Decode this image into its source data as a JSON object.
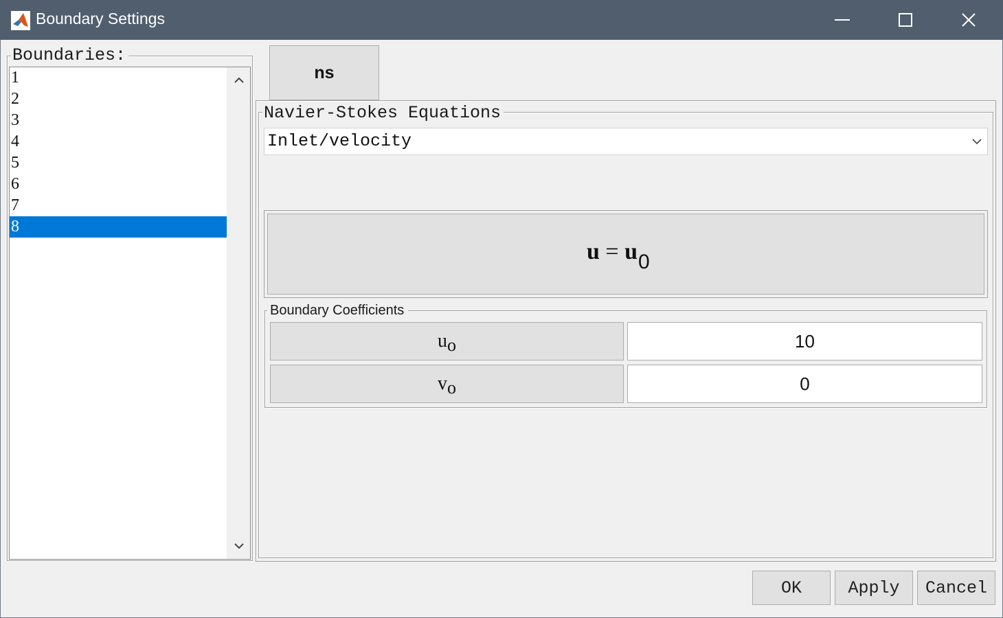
{
  "window": {
    "title": "Boundary Settings",
    "icon": "matlab-icon"
  },
  "boundaries": {
    "legend": "Boundaries:",
    "items": [
      "1",
      "2",
      "3",
      "4",
      "5",
      "6",
      "7",
      "8"
    ],
    "selected": "8"
  },
  "tab": {
    "label": "ns"
  },
  "equations": {
    "legend": "Navier-Stokes Equations",
    "condition_type": "Inlet/velocity",
    "equation_lhs": "u",
    "equation_op": "=",
    "equation_rhs": "u",
    "equation_rhs_sub": "0"
  },
  "coefficients": {
    "legend": "Boundary Coefficients",
    "rows": [
      {
        "symbol": "u",
        "sub": "o",
        "value": "10"
      },
      {
        "symbol": "v",
        "sub": "o",
        "value": "0"
      }
    ]
  },
  "buttons": {
    "ok": "OK",
    "apply": "Apply",
    "cancel": "Cancel"
  },
  "colors": {
    "titlebar": "#505e6e",
    "selection": "#0078d7"
  }
}
